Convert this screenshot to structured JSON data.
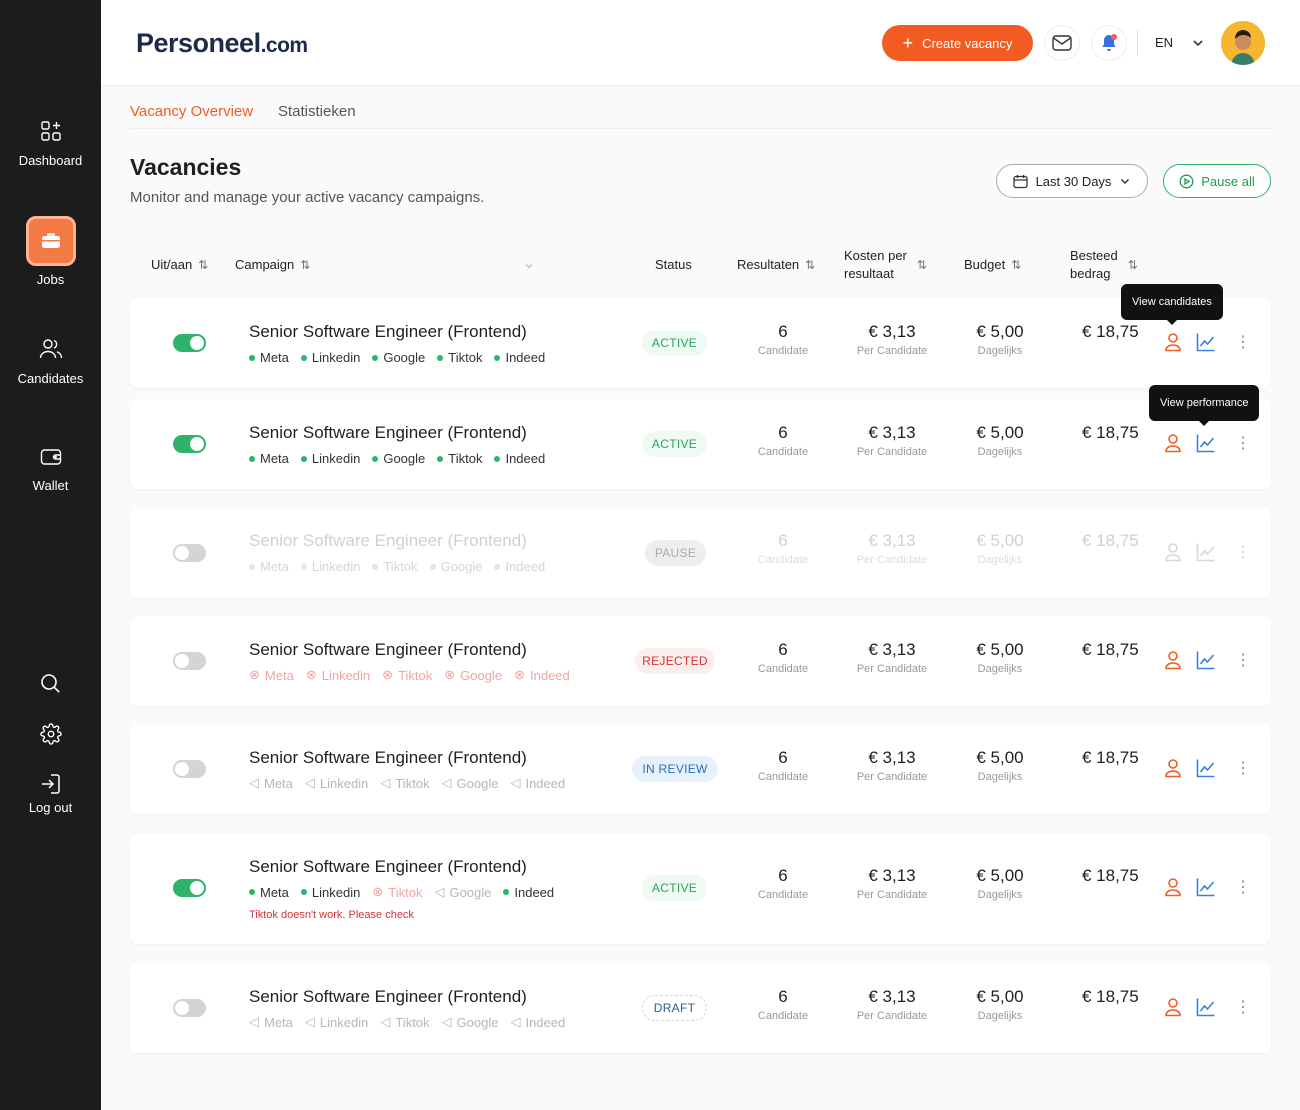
{
  "sidebar": {
    "items": [
      {
        "label": "Dashboard",
        "icon": "dashboard-icon"
      },
      {
        "label": "Jobs",
        "icon": "briefcase-icon"
      },
      {
        "label": "Candidates",
        "icon": "users-icon"
      },
      {
        "label": "Wallet",
        "icon": "wallet-icon"
      }
    ],
    "logout_label": "Log out"
  },
  "header": {
    "logo_main": "Personeel",
    "logo_suffix": ".com",
    "create_label": "Create vacancy",
    "language": "EN"
  },
  "tabs": [
    {
      "label": "Vacancy Overview",
      "active": true
    },
    {
      "label": "Statistieken",
      "active": false
    }
  ],
  "page": {
    "title": "Vacancies",
    "subtitle": "Monitor and manage your active vacancy campaigns.",
    "date_filter": "Last 30 Days",
    "pause_all": "Pause all"
  },
  "table": {
    "headers": {
      "toggle": "Uit/aan",
      "campaign": "Campaign",
      "status": "Status",
      "results": "Resultaten",
      "cost_line1": "Kosten per",
      "cost_line2": "resultaat",
      "budget": "Budget",
      "spent_line1": "Besteed",
      "spent_line2": "bedrag"
    },
    "results_sub": "Candidate",
    "cost_sub": "Per Candidate",
    "budget_sub": "Dagelijks",
    "rows": [
      {
        "title": "Senior Software Engineer (Frontend)",
        "status": "ACTIVE",
        "results": "6",
        "cost": "€ 3,13",
        "budget": "€ 5,00",
        "spent": "€ 18,75",
        "channels": [
          "Meta",
          "Linkedin",
          "Google",
          "Tiktok",
          "Indeed"
        ]
      },
      {
        "title": "Senior Software Engineer (Frontend)",
        "status": "ACTIVE",
        "results": "6",
        "cost": "€ 3,13",
        "budget": "€ 5,00",
        "spent": "€ 18,75",
        "channels": [
          "Meta",
          "Linkedin",
          "Google",
          "Tiktok",
          "Indeed"
        ]
      },
      {
        "title": "Senior Software Engineer (Frontend)",
        "status": "PAUSE",
        "results": "6",
        "cost": "€ 3,13",
        "budget": "€ 5,00",
        "spent": "€ 18,75",
        "channels": [
          "Meta",
          "Linkedin",
          "Tiktok",
          "Google",
          "Indeed"
        ]
      },
      {
        "title": "Senior Software Engineer (Frontend)",
        "status": "REJECTED",
        "results": "6",
        "cost": "€ 3,13",
        "budget": "€ 5,00",
        "spent": "€ 18,75",
        "channels": [
          "Meta",
          "Linkedin",
          "Tiktok",
          "Google",
          "Indeed"
        ]
      },
      {
        "title": "Senior Software Engineer (Frontend)",
        "status": "IN REVIEW",
        "results": "6",
        "cost": "€ 3,13",
        "budget": "€ 5,00",
        "spent": "€ 18,75",
        "channels": [
          "Meta",
          "Linkedin",
          "Tiktok",
          "Google",
          "Indeed"
        ]
      },
      {
        "title": "Senior Software Engineer (Frontend)",
        "status": "ACTIVE",
        "results": "6",
        "cost": "€ 3,13",
        "budget": "€ 5,00",
        "spent": "€ 18,75",
        "channels": [
          "Meta",
          "Linkedin",
          "Tiktok",
          "Google",
          "Indeed"
        ],
        "error": "Tiktok doesn't work. Please check"
      },
      {
        "title": "Senior Software Engineer (Frontend)",
        "status": "DRAFT",
        "results": "6",
        "cost": "€ 3,13",
        "budget": "€ 5,00",
        "spent": "€ 18,75",
        "channels": [
          "Meta",
          "Linkedin",
          "Tiktok",
          "Google",
          "Indeed"
        ]
      }
    ]
  },
  "tooltips": {
    "candidates": "View candidates",
    "performance": "View performance"
  },
  "colors": {
    "accent": "#f25c22",
    "active_green": "#2db36a",
    "sidebar_bg": "#1c1c1c",
    "chart_blue": "#3b82d6"
  }
}
